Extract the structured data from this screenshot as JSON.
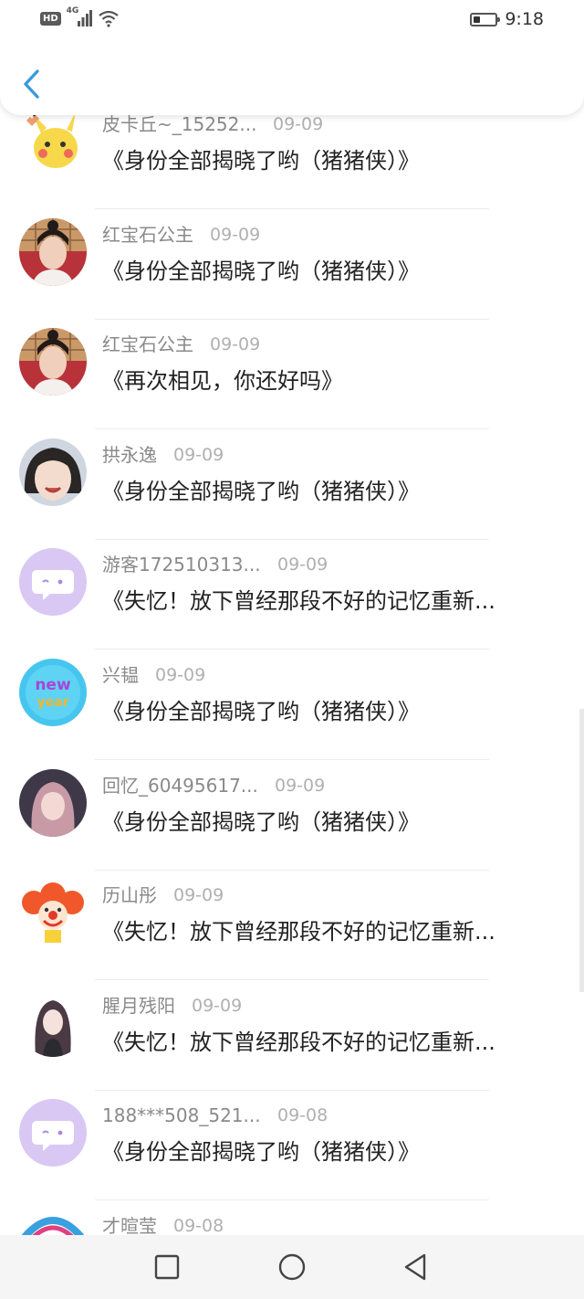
{
  "status_bar": {
    "hd_label": "HD",
    "network_label": "4G",
    "time": "9:18",
    "battery_level": 0.25,
    "icons": [
      "hd-icon",
      "signal-icon",
      "wifi-icon",
      "battery-icon"
    ]
  },
  "header": {
    "back_icon": "chevron-left-icon",
    "accent_color": "#3a9bdc"
  },
  "comments": [
    {
      "name": "皮卡丘~_15252...",
      "date": "09-09",
      "text": "《身份全部揭晓了哟（猪猪侠）》",
      "avatar": "pikachu"
    },
    {
      "name": "红宝石公主",
      "date": "09-09",
      "text": "《身份全部揭晓了哟（猪猪侠）》",
      "avatar": "girl-photo"
    },
    {
      "name": "红宝石公主",
      "date": "09-09",
      "text": "《再次相见，你还好吗》",
      "avatar": "girl-photo"
    },
    {
      "name": "拱永逸",
      "date": "09-09",
      "text": "《身份全部揭晓了哟（猪猪侠）》",
      "avatar": "child-photo"
    },
    {
      "name": "游客172510313...",
      "date": "09-09",
      "text": "《失忆！放下曾经那段不好的记忆重新...",
      "avatar": "default-chat"
    },
    {
      "name": "兴韫",
      "date": "09-09",
      "text": "《身份全部揭晓了哟（猪猪侠）》",
      "avatar": "new-year"
    },
    {
      "name": "回忆_60495617...",
      "date": "09-09",
      "text": "《身份全部揭晓了哟（猪猪侠）》",
      "avatar": "anime-girl"
    },
    {
      "name": "历山彤",
      "date": "09-09",
      "text": "《失忆！放下曾经那段不好的记忆重新...",
      "avatar": "clown"
    },
    {
      "name": "腥月残阳",
      "date": "09-09",
      "text": "《失忆！放下曾经那段不好的记忆重新...",
      "avatar": "anime-dark"
    },
    {
      "name": "188***508_521...",
      "date": "09-08",
      "text": "《身份全部揭晓了哟（猪猪侠）》",
      "avatar": "default-chat"
    },
    {
      "name": "才暄莹",
      "date": "09-08",
      "text": "",
      "avatar": "colorful"
    }
  ],
  "nav_bar": {
    "icons": [
      "recent-apps-icon",
      "home-icon",
      "back-icon"
    ]
  }
}
